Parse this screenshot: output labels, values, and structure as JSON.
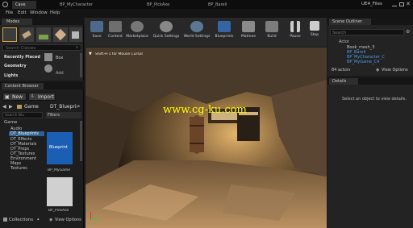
{
  "window": {
    "tabs": [
      "Cave",
      "BP_MyCharacter",
      "BP_PickAxe",
      "BP_Barell"
    ],
    "project": "UE4_Files"
  },
  "menu": [
    "File",
    "Edit",
    "Window",
    "Help"
  ],
  "modes": {
    "title": "Modes",
    "search_placeholder": "Search Classes",
    "categories": [
      "Recently Placed",
      "Geometry",
      "Lights"
    ],
    "items": [
      "Box",
      "Add"
    ]
  },
  "content_browser": {
    "title": "Content Browser",
    "new_label": "New",
    "import_label": "Import",
    "path": [
      "Game",
      "DT_Blueprints"
    ],
    "search_placeholder": "Search Blu",
    "filters_label": "Filters",
    "tree": [
      "Game",
      "Audio",
      "DT_Blueprints",
      "DT_Effects",
      "DT_Materials",
      "DT_Props",
      "DT_Textures",
      "Environment",
      "Maps",
      "Textures"
    ],
    "assets": [
      "Blueprint",
      "BP_MyGame",
      "BP_PickAxe"
    ],
    "collections_label": "Collections",
    "view_options_label": "View Options"
  },
  "toolbar": {
    "buttons": [
      "Save",
      "Content",
      "Marketplace",
      "Quick Settings",
      "World Settings",
      "Blueprints",
      "Matinee",
      "Build",
      "Pause",
      "Stop"
    ]
  },
  "viewport": {
    "hint": "Shift+F1 for Mouse Cursor",
    "watermark": "www.cg-ku.com"
  },
  "outliner": {
    "title": "Scene Outliner",
    "search_placeholder": "Search",
    "column": "Actor",
    "rows": [
      "Book_mesh_3",
      "BP_Barell",
      "BP_MyCharacter_C",
      "BP_MyGame_C4"
    ],
    "count": "84 actors",
    "view_options_label": "View Options"
  },
  "details": {
    "title": "Details",
    "message": "Select an object to view details."
  },
  "colors": {
    "accent": "#3d8ad8",
    "watermark": "#ffff00",
    "selection": "#2f5f8e"
  }
}
